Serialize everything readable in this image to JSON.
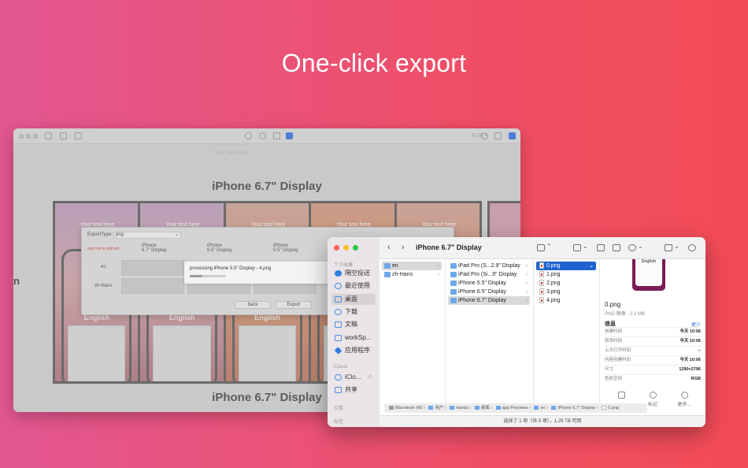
{
  "hero": {
    "title": "One-click export"
  },
  "app": {
    "toolbar": {
      "zoom": "6:28 •"
    },
    "frame_title_top": "iPhone 6.7\" Display",
    "frame_title_bottom": "iPhone 6.7\" Display",
    "top_placeholder": "Your text here",
    "card_placeholder": "Your text here",
    "card_label": "English",
    "side_letter": "n",
    "export_sheet": {
      "export_type_label": "ExportType:",
      "export_type_value": "png",
      "zap_hint": "zap row to add etc",
      "columns": [
        "iPhone\n6.7\" Display",
        "iPhone\n6.5\" Display",
        "iPhone\n5.5\" Display"
      ],
      "rows": [
        "en",
        "zh-Hans"
      ],
      "back_label": "back",
      "export_label": "Export",
      "progress": {
        "text": "processing iPhone 5.5\" Display - 4.png",
        "fraction": 0.35
      }
    }
  },
  "finder": {
    "title": "iPhone 6.7\" Display",
    "sidebar": {
      "section_personal": "个人收藏",
      "items": [
        {
          "label": "隔空投送",
          "icon": "airdrop-icon"
        },
        {
          "label": "最近使用",
          "icon": "clock-icon"
        },
        {
          "label": "桌面",
          "icon": "desktop-icon",
          "active": true
        },
        {
          "label": "下载",
          "icon": "download-icon"
        },
        {
          "label": "文稿",
          "icon": "document-icon"
        },
        {
          "label": "workSp...",
          "icon": "folder-icon"
        },
        {
          "label": "应用程序",
          "icon": "apps-icon"
        }
      ],
      "section_icloud": "iCloud",
      "icloud_items": [
        {
          "label": "iClo...",
          "icon": "cloud-icon",
          "warning": "⚠"
        },
        {
          "label": "共享",
          "icon": "shared-folder-icon"
        }
      ],
      "section_locations": "位置",
      "section_tags": "标签"
    },
    "columns": {
      "col1": [
        "en",
        "zh-Hans"
      ],
      "col2": [
        "iPad Pro (S...2.9\" Display",
        "iPad Pro (Si...9\" Display",
        "iPhone 5.5\" Display",
        "iPhone 6.5\" Display",
        "iPhone 6.7\" Display"
      ],
      "col3": [
        "0.png",
        "1.png",
        "2.png",
        "3.png",
        "4.png"
      ]
    },
    "preview": {
      "thumb_text": "English",
      "name": "0.png",
      "subtitle": "PNG 图像 - 2.2 MB",
      "info_label": "信息",
      "more_label": "更少",
      "rows": [
        {
          "k": "创建时间",
          "v": "今天 10:06"
        },
        {
          "k": "修改时间",
          "v": "今天 10:06"
        },
        {
          "k": "上次打开时间",
          "v": "--"
        },
        {
          "k": "内容创建时间",
          "v": "今天 10:06"
        },
        {
          "k": "尺寸",
          "v": "1290×2796"
        },
        {
          "k": "色彩空间",
          "v": "RGB"
        }
      ],
      "actions": [
        "标记",
        "更多..."
      ]
    },
    "pathbar": [
      "Macintosh HD",
      "用户",
      "handa",
      "桌面",
      "app Previews",
      "en",
      "iPhone 6.7\" Display",
      "0.png"
    ],
    "status": "选择了 1 项（共 5 项），1.29 TB 可用"
  }
}
